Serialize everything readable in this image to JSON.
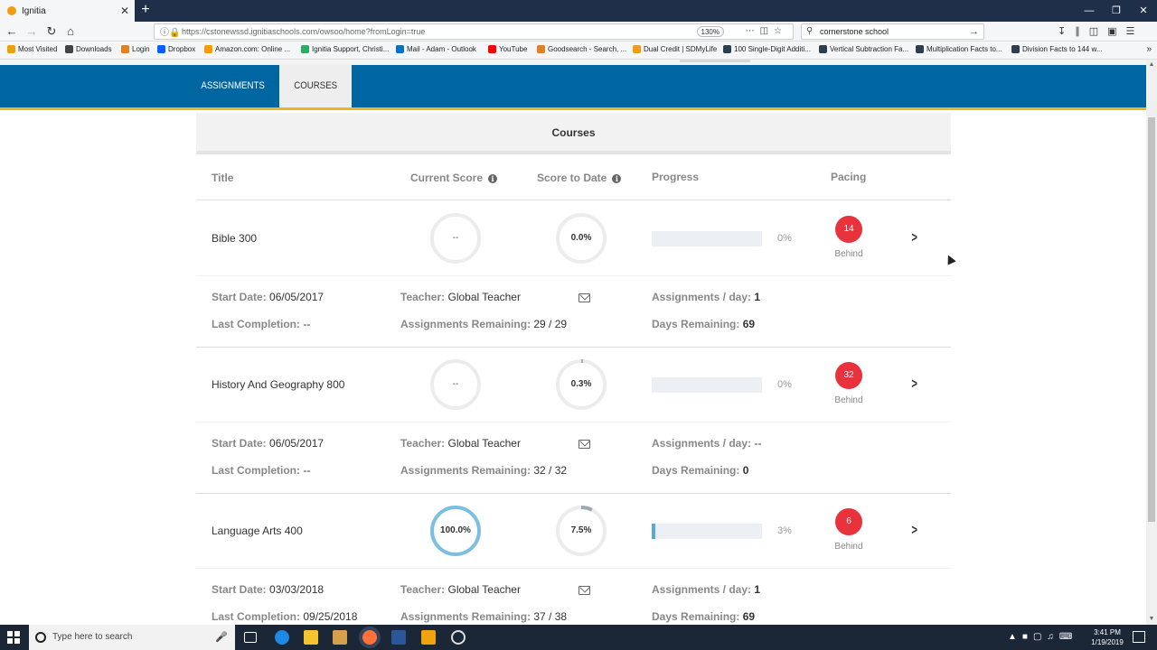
{
  "browser": {
    "tab_title": "Ignitia",
    "tab_close": "✕",
    "new_tab": "+",
    "url": "https://cstonewssd.ignitiaschools.com/owsoo/home?fromLogin=true",
    "zoom": "130%",
    "search_value": "cornerstone school",
    "bookmarks": [
      {
        "label": "Most Visited",
        "color": "#f39c12"
      },
      {
        "label": "Downloads",
        "color": "#444444"
      },
      {
        "label": "Login",
        "color": "#e67e22"
      },
      {
        "label": "Dropbox",
        "color": "#0061fe"
      },
      {
        "label": "Amazon.com: Online ...",
        "color": "#ff9900"
      },
      {
        "label": "Ignitia Support, Christi...",
        "color": "#27ae60"
      },
      {
        "label": "Mail - Adam - Outlook",
        "color": "#0072c6"
      },
      {
        "label": "YouTube",
        "color": "#ff0000"
      },
      {
        "label": "Goodsearch - Search, ...",
        "color": "#e67e22"
      },
      {
        "label": "Dual Credit | SDMyLife",
        "color": "#f39c12"
      },
      {
        "label": "100 Single-Digit Additi...",
        "color": "#2c3e50"
      },
      {
        "label": "Vertical Subtraction Fa...",
        "color": "#2c3e50"
      },
      {
        "label": "Multiplication Facts to...",
        "color": "#2c3e50"
      },
      {
        "label": "Division Facts to 144 w...",
        "color": "#2c3e50"
      }
    ]
  },
  "nav": {
    "tabs": [
      {
        "label": "ASSIGNMENTS",
        "active": false
      },
      {
        "label": "COURSES",
        "active": true
      }
    ],
    "brand_color": "#0066a1",
    "accent_color": "#f0b323"
  },
  "panel": {
    "title": "Courses",
    "columns": {
      "title": "Title",
      "current_score": "Current Score",
      "score_to_date": "Score to Date",
      "progress": "Progress",
      "pacing": "Pacing"
    },
    "labels": {
      "start_date": "Start Date:",
      "teacher": "Teacher:",
      "assignments_per_day": "Assignments / day:",
      "last_completion": "Last Completion:",
      "assignments_remaining": "Assignments Remaining:",
      "days_remaining": "Days Remaining:",
      "behind": "Behind"
    }
  },
  "courses": [
    {
      "title": "Bible 300",
      "current_score": "--",
      "current_score_fraction": 0,
      "score_to_date": "0.0%",
      "score_to_date_fraction": 0,
      "progress_pct": "0%",
      "progress_fraction": 0,
      "pacing": "14",
      "start_date": "06/05/2017",
      "teacher": "Global Teacher",
      "assignments_per_day": "1",
      "last_completion": "--",
      "assignments_remaining": "29 / 29",
      "days_remaining": "69"
    },
    {
      "title": "History And Geography 800",
      "current_score": "--",
      "current_score_fraction": 0,
      "score_to_date": "0.3%",
      "score_to_date_fraction": 0.003,
      "progress_pct": "0%",
      "progress_fraction": 0,
      "pacing": "32",
      "start_date": "06/05/2017",
      "teacher": "Global Teacher",
      "assignments_per_day": "--",
      "last_completion": "--",
      "assignments_remaining": "32 / 32",
      "days_remaining": "0"
    },
    {
      "title": "Language Arts 400",
      "current_score": "100.0%",
      "current_score_fraction": 1,
      "score_to_date": "7.5%",
      "score_to_date_fraction": 0.075,
      "progress_pct": "3%",
      "progress_fraction": 0.03,
      "pacing": "6",
      "start_date": "03/03/2018",
      "teacher": "Global Teacher",
      "assignments_per_day": "1",
      "last_completion": "09/25/2018",
      "assignments_remaining": "37 / 38",
      "days_remaining": "69"
    }
  ],
  "taskbar": {
    "search_placeholder": "Type here to search",
    "time": "3:41 PM",
    "date": "1/19/2019"
  }
}
